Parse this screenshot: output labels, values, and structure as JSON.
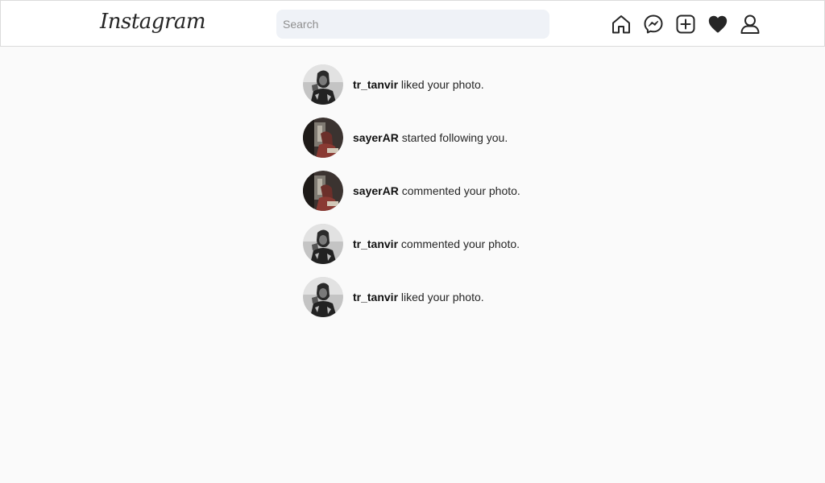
{
  "header": {
    "logo_text": "Instagram",
    "search_placeholder": "Search"
  },
  "nav_icons": [
    "home-icon",
    "messenger-icon",
    "new-post-icon",
    "activity-heart-icon",
    "profile-icon"
  ],
  "notifications": [
    {
      "username": "tr_tanvir",
      "action": " liked your photo.",
      "avatar": "bw-portrait"
    },
    {
      "username": "sayerAR",
      "action": " started following you.",
      "avatar": "color-portrait"
    },
    {
      "username": "sayerAR",
      "action": " commented your photo.",
      "avatar": "color-portrait"
    },
    {
      "username": "tr_tanvir",
      "action": " commented your photo.",
      "avatar": "bw-portrait"
    },
    {
      "username": "tr_tanvir",
      "action": " liked your photo.",
      "avatar": "bw-portrait"
    }
  ]
}
